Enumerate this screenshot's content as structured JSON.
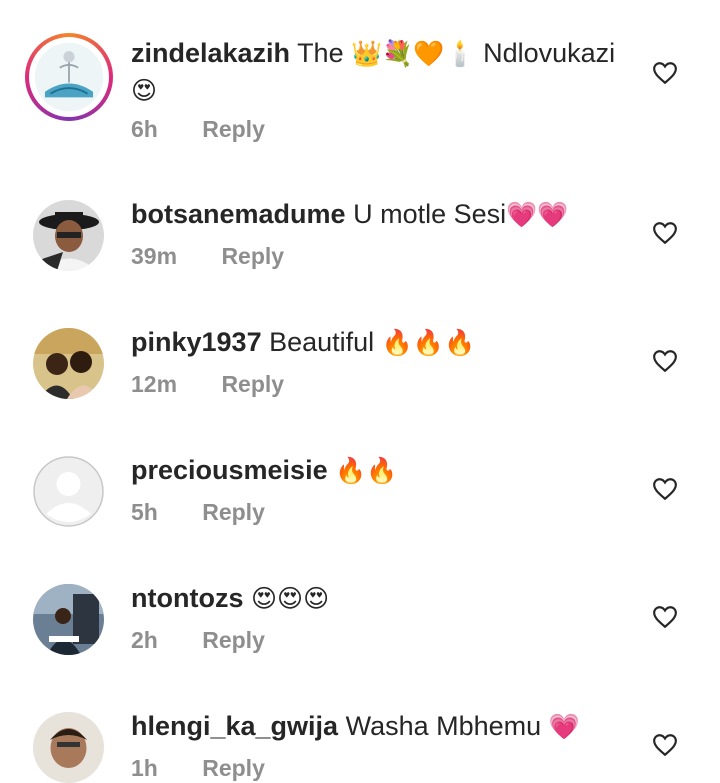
{
  "comments": [
    {
      "username": "zindelakazih",
      "text": "The ",
      "emoji": "👑💐🧡🕯️",
      "text2": " Ndlovukazi",
      "emoji2": "😍",
      "time": "6h",
      "reply": "Reply"
    },
    {
      "username": "botsanemadume",
      "text": "U motle Sesi",
      "emoji": "💗💗",
      "time": "39m",
      "reply": "Reply"
    },
    {
      "username": "pinky1937",
      "text": "Beautiful ",
      "emoji": "🔥🔥🔥",
      "time": "12m",
      "reply": "Reply"
    },
    {
      "username": "preciousmeisie",
      "text": " ",
      "emoji": "🔥🔥",
      "time": "5h",
      "reply": "Reply"
    },
    {
      "username": "ntontozs",
      "text": " ",
      "emoji": "😍😍😍",
      "time": "2h",
      "reply": "Reply"
    },
    {
      "username": "hlengi_ka_gwija",
      "text": "Washa Mbhemu ",
      "emoji": "💗",
      "time": "1h",
      "reply": "Reply"
    }
  ],
  "colors": {
    "username": "#262626",
    "meta": "#8e8e8e",
    "heart_stroke": "#262626",
    "story_ring": "#e1306c"
  }
}
